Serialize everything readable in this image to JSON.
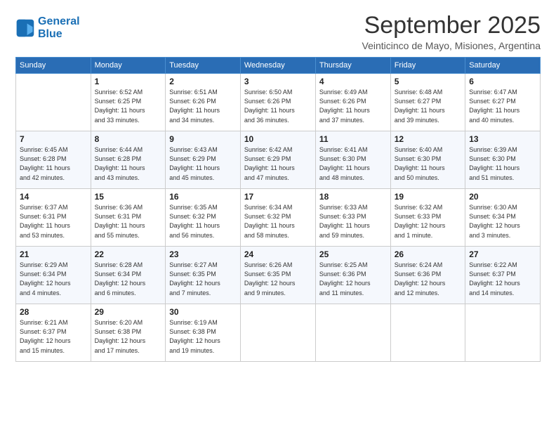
{
  "logo": {
    "line1": "General",
    "line2": "Blue"
  },
  "header": {
    "title": "September 2025",
    "subtitle": "Veinticinco de Mayo, Misiones, Argentina"
  },
  "weekdays": [
    "Sunday",
    "Monday",
    "Tuesday",
    "Wednesday",
    "Thursday",
    "Friday",
    "Saturday"
  ],
  "weeks": [
    [
      {
        "day": "",
        "info": ""
      },
      {
        "day": "1",
        "info": "Sunrise: 6:52 AM\nSunset: 6:25 PM\nDaylight: 11 hours\nand 33 minutes."
      },
      {
        "day": "2",
        "info": "Sunrise: 6:51 AM\nSunset: 6:26 PM\nDaylight: 11 hours\nand 34 minutes."
      },
      {
        "day": "3",
        "info": "Sunrise: 6:50 AM\nSunset: 6:26 PM\nDaylight: 11 hours\nand 36 minutes."
      },
      {
        "day": "4",
        "info": "Sunrise: 6:49 AM\nSunset: 6:26 PM\nDaylight: 11 hours\nand 37 minutes."
      },
      {
        "day": "5",
        "info": "Sunrise: 6:48 AM\nSunset: 6:27 PM\nDaylight: 11 hours\nand 39 minutes."
      },
      {
        "day": "6",
        "info": "Sunrise: 6:47 AM\nSunset: 6:27 PM\nDaylight: 11 hours\nand 40 minutes."
      }
    ],
    [
      {
        "day": "7",
        "info": "Sunrise: 6:45 AM\nSunset: 6:28 PM\nDaylight: 11 hours\nand 42 minutes."
      },
      {
        "day": "8",
        "info": "Sunrise: 6:44 AM\nSunset: 6:28 PM\nDaylight: 11 hours\nand 43 minutes."
      },
      {
        "day": "9",
        "info": "Sunrise: 6:43 AM\nSunset: 6:29 PM\nDaylight: 11 hours\nand 45 minutes."
      },
      {
        "day": "10",
        "info": "Sunrise: 6:42 AM\nSunset: 6:29 PM\nDaylight: 11 hours\nand 47 minutes."
      },
      {
        "day": "11",
        "info": "Sunrise: 6:41 AM\nSunset: 6:30 PM\nDaylight: 11 hours\nand 48 minutes."
      },
      {
        "day": "12",
        "info": "Sunrise: 6:40 AM\nSunset: 6:30 PM\nDaylight: 11 hours\nand 50 minutes."
      },
      {
        "day": "13",
        "info": "Sunrise: 6:39 AM\nSunset: 6:30 PM\nDaylight: 11 hours\nand 51 minutes."
      }
    ],
    [
      {
        "day": "14",
        "info": "Sunrise: 6:37 AM\nSunset: 6:31 PM\nDaylight: 11 hours\nand 53 minutes."
      },
      {
        "day": "15",
        "info": "Sunrise: 6:36 AM\nSunset: 6:31 PM\nDaylight: 11 hours\nand 55 minutes."
      },
      {
        "day": "16",
        "info": "Sunrise: 6:35 AM\nSunset: 6:32 PM\nDaylight: 11 hours\nand 56 minutes."
      },
      {
        "day": "17",
        "info": "Sunrise: 6:34 AM\nSunset: 6:32 PM\nDaylight: 11 hours\nand 58 minutes."
      },
      {
        "day": "18",
        "info": "Sunrise: 6:33 AM\nSunset: 6:33 PM\nDaylight: 11 hours\nand 59 minutes."
      },
      {
        "day": "19",
        "info": "Sunrise: 6:32 AM\nSunset: 6:33 PM\nDaylight: 12 hours\nand 1 minute."
      },
      {
        "day": "20",
        "info": "Sunrise: 6:30 AM\nSunset: 6:34 PM\nDaylight: 12 hours\nand 3 minutes."
      }
    ],
    [
      {
        "day": "21",
        "info": "Sunrise: 6:29 AM\nSunset: 6:34 PM\nDaylight: 12 hours\nand 4 minutes."
      },
      {
        "day": "22",
        "info": "Sunrise: 6:28 AM\nSunset: 6:34 PM\nDaylight: 12 hours\nand 6 minutes."
      },
      {
        "day": "23",
        "info": "Sunrise: 6:27 AM\nSunset: 6:35 PM\nDaylight: 12 hours\nand 7 minutes."
      },
      {
        "day": "24",
        "info": "Sunrise: 6:26 AM\nSunset: 6:35 PM\nDaylight: 12 hours\nand 9 minutes."
      },
      {
        "day": "25",
        "info": "Sunrise: 6:25 AM\nSunset: 6:36 PM\nDaylight: 12 hours\nand 11 minutes."
      },
      {
        "day": "26",
        "info": "Sunrise: 6:24 AM\nSunset: 6:36 PM\nDaylight: 12 hours\nand 12 minutes."
      },
      {
        "day": "27",
        "info": "Sunrise: 6:22 AM\nSunset: 6:37 PM\nDaylight: 12 hours\nand 14 minutes."
      }
    ],
    [
      {
        "day": "28",
        "info": "Sunrise: 6:21 AM\nSunset: 6:37 PM\nDaylight: 12 hours\nand 15 minutes."
      },
      {
        "day": "29",
        "info": "Sunrise: 6:20 AM\nSunset: 6:38 PM\nDaylight: 12 hours\nand 17 minutes."
      },
      {
        "day": "30",
        "info": "Sunrise: 6:19 AM\nSunset: 6:38 PM\nDaylight: 12 hours\nand 19 minutes."
      },
      {
        "day": "",
        "info": ""
      },
      {
        "day": "",
        "info": ""
      },
      {
        "day": "",
        "info": ""
      },
      {
        "day": "",
        "info": ""
      }
    ]
  ]
}
